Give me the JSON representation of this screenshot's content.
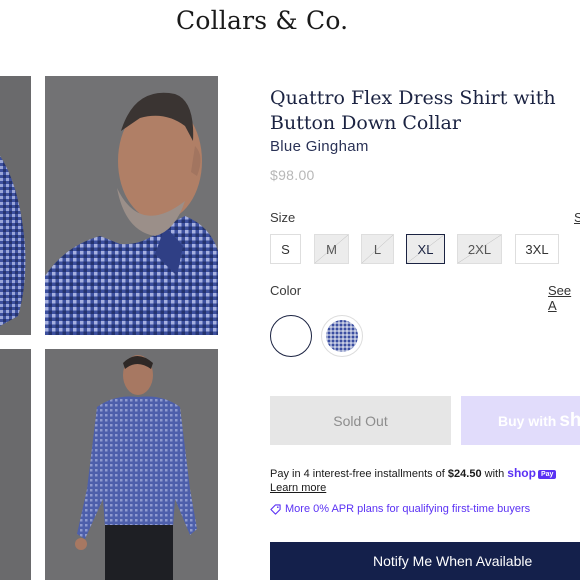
{
  "brand": {
    "name": "Collars & Co."
  },
  "product": {
    "title_line1": "Quattro Flex Dress Shirt with",
    "title_line2": "Button Down Collar",
    "variant": "Blue Gingham",
    "price": "$98.00"
  },
  "size": {
    "label": "Size",
    "chart_link": "S",
    "options": [
      {
        "label": "S",
        "available": true,
        "selected": false
      },
      {
        "label": "M",
        "available": false,
        "selected": false
      },
      {
        "label": "L",
        "available": false,
        "selected": false
      },
      {
        "label": "XL",
        "available": false,
        "selected": true
      },
      {
        "label": "2XL",
        "available": false,
        "selected": false
      },
      {
        "label": "3XL",
        "available": true,
        "selected": false
      }
    ]
  },
  "color": {
    "label": "Color",
    "see_all": "See A",
    "options": [
      {
        "name": "white-swatch",
        "hex": "#ffffff",
        "selected": true
      },
      {
        "name": "blue-gingham-swatch",
        "hex": "#3b4ea1",
        "selected": false
      }
    ]
  },
  "actions": {
    "sold_out": "Sold Out",
    "buy_with": "Buy with",
    "buy_with_logo": "sh",
    "notify": "Notify Me When Available"
  },
  "payments": {
    "installment_prefix": "Pay in 4 interest-free installments of ",
    "installment_amount": "$24.50",
    "installment_with": " with ",
    "shop_logo": "shop",
    "pay_badge": "Pay",
    "learn_more": "Learn more",
    "apr_text": "More 0% APR plans for qualifying first-time buyers"
  },
  "colors": {
    "navy": "#14204b",
    "shop_purple": "#5a31f4",
    "shop_button": "#e1dcfb"
  }
}
